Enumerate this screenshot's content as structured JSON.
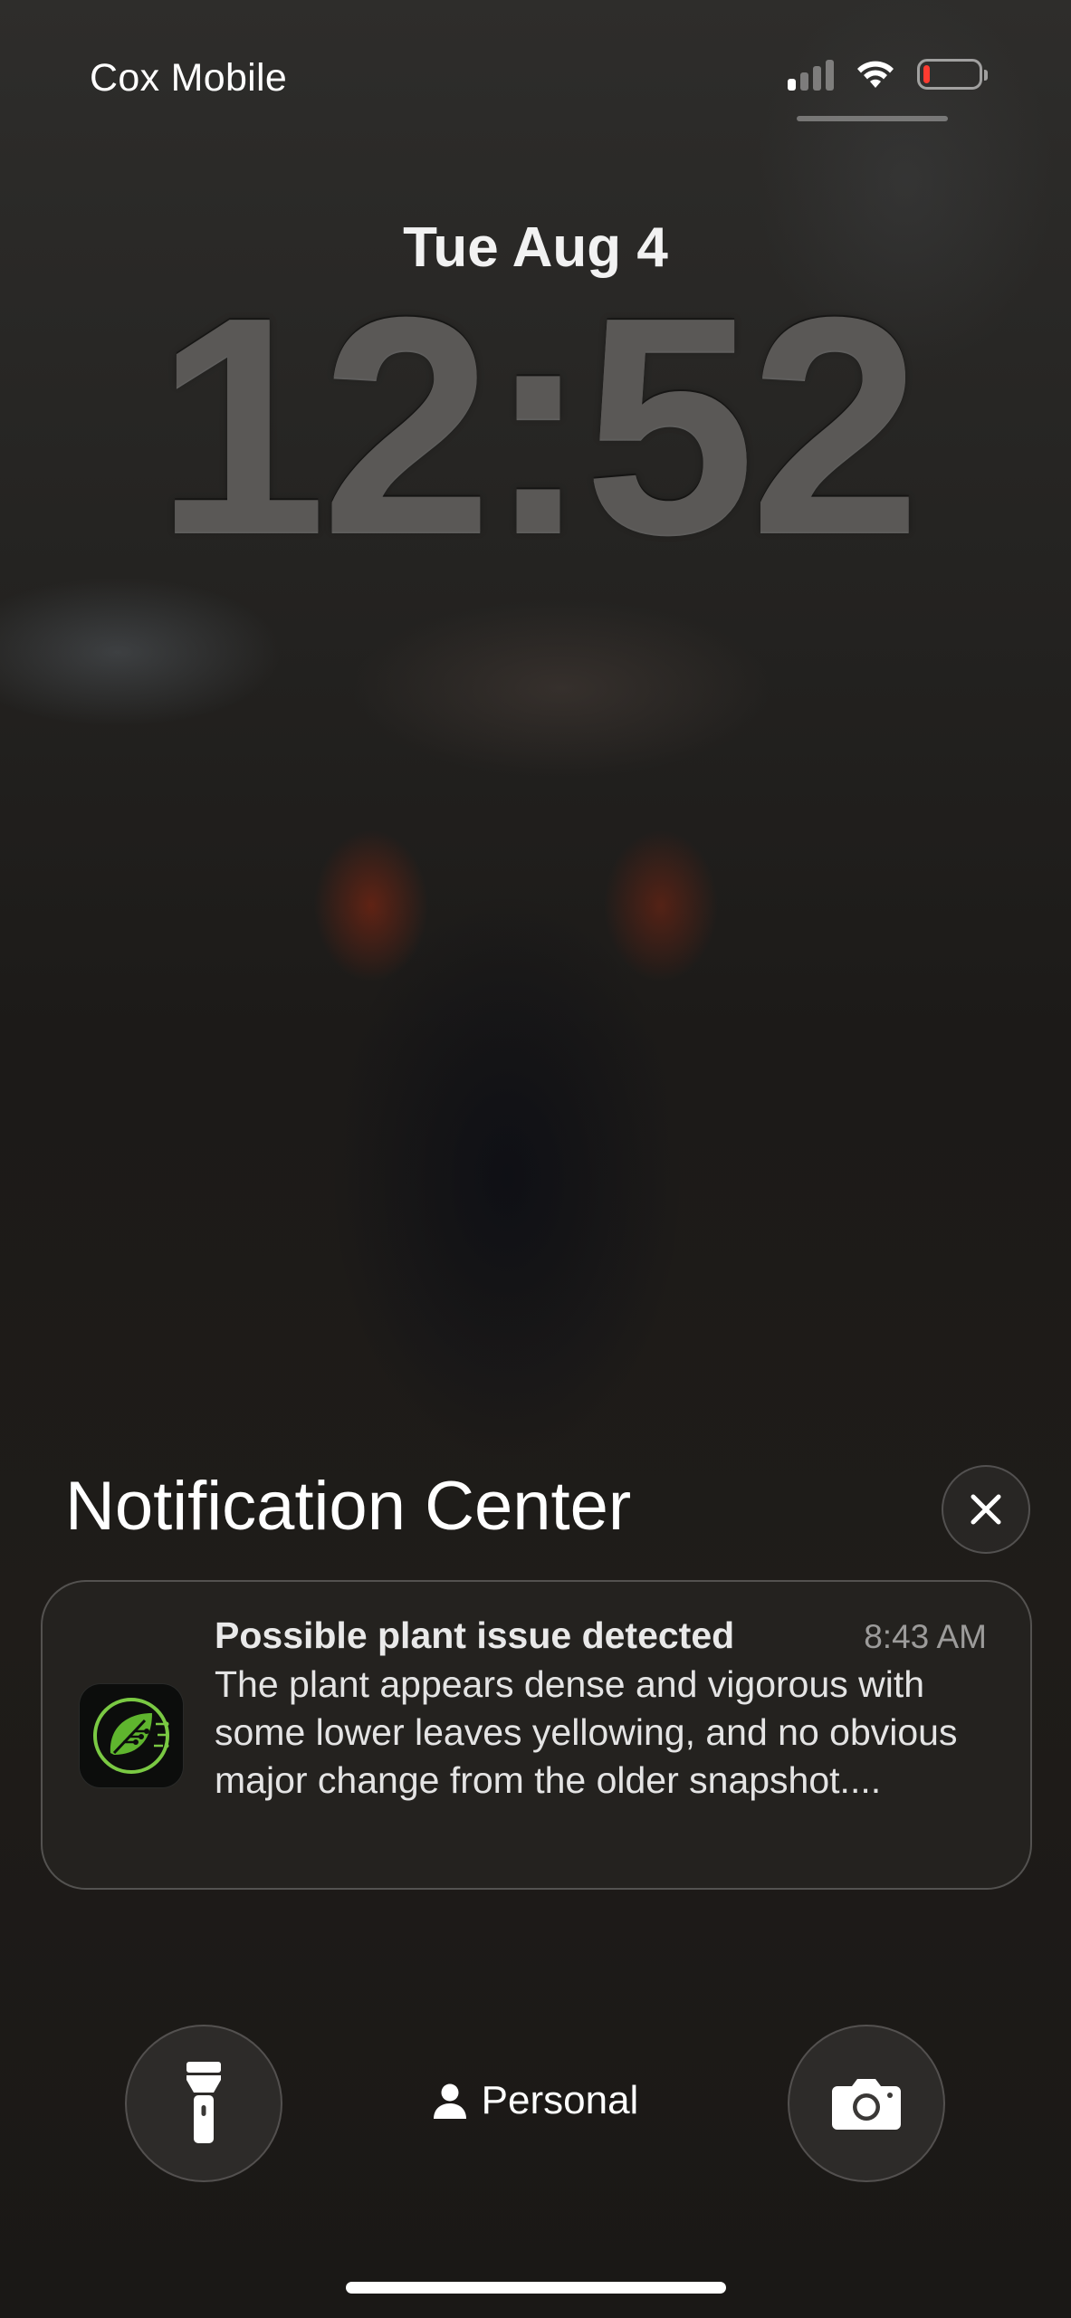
{
  "status_bar": {
    "carrier": "Cox Mobile",
    "signal_bars_active": 1,
    "signal_bars_total": 4,
    "battery_level": 0.1,
    "battery_color": "#ff3b30",
    "icons": [
      "signal-icon",
      "wifi-icon",
      "battery-icon"
    ]
  },
  "lock_screen": {
    "date": "Tue Aug 4",
    "time": "12:52"
  },
  "notification_center": {
    "title": "Notification Center",
    "close_icon": "close-icon",
    "notifications": [
      {
        "app_icon": "plant-leaf-circuit-icon",
        "title": "Possible plant issue detected",
        "time": "8:43 AM",
        "body": "The plant appears dense and vigorous with some lower leaves yellowing, and no obvious major change from the older snapshot...."
      }
    ]
  },
  "bottom_bar": {
    "flashlight_icon": "flashlight-icon",
    "focus_icon": "person-icon",
    "focus_label": "Personal",
    "camera_icon": "camera-icon"
  }
}
